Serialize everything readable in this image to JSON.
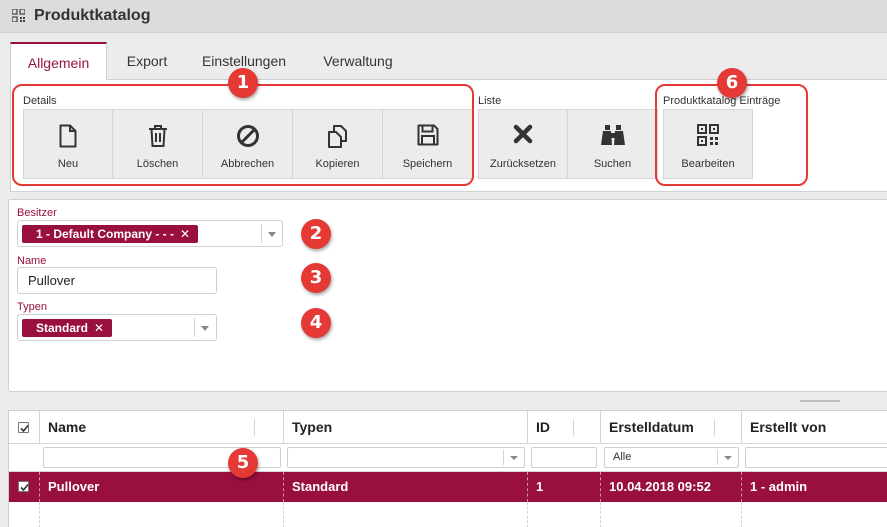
{
  "window": {
    "title": "Produktkatalog",
    "icon": "qr-code-icon"
  },
  "tabs": [
    {
      "label": "Allgemein",
      "active": true
    },
    {
      "label": "Export",
      "active": false
    },
    {
      "label": "Einstellungen",
      "active": false
    },
    {
      "label": "Verwaltung",
      "active": false
    }
  ],
  "toolbar": {
    "groups": [
      {
        "label": "Details",
        "buttons": [
          {
            "label": "Neu",
            "icon": "new-document-icon"
          },
          {
            "label": "Löschen",
            "icon": "trash-icon"
          },
          {
            "label": "Abbrechen",
            "icon": "cancel-icon"
          },
          {
            "label": "Kopieren",
            "icon": "copy-icon"
          },
          {
            "label": "Speichern",
            "icon": "save-icon"
          }
        ]
      },
      {
        "label": "Liste",
        "buttons": [
          {
            "label": "Zurücksetzen",
            "icon": "reset-x-icon"
          },
          {
            "label": "Suchen",
            "icon": "binoculars-icon"
          }
        ]
      },
      {
        "label": "Produktkatalog Einträge",
        "buttons": [
          {
            "label": "Bearbeiten",
            "icon": "qr-code-icon"
          }
        ]
      }
    ]
  },
  "form": {
    "owner": {
      "label": "Besitzer",
      "value": "1 - Default Company - - -"
    },
    "name": {
      "label": "Name",
      "value": "Pullover"
    },
    "types": {
      "label": "Typen",
      "value": "Standard"
    }
  },
  "grid": {
    "columns": [
      "Name",
      "Typen",
      "ID",
      "Erstelldatum",
      "Erstellt von"
    ],
    "filters": {
      "created_date": "Alle"
    },
    "rows": [
      {
        "checked": true,
        "name": "Pullover",
        "types": "Standard",
        "id": "1",
        "created": "10.04.2018 09:52",
        "created_by": "1 - admin"
      }
    ]
  },
  "annotations": [
    "1",
    "2",
    "3",
    "4",
    "5",
    "6"
  ],
  "colors": {
    "accent": "#99103e",
    "annotation": "#e53935"
  }
}
